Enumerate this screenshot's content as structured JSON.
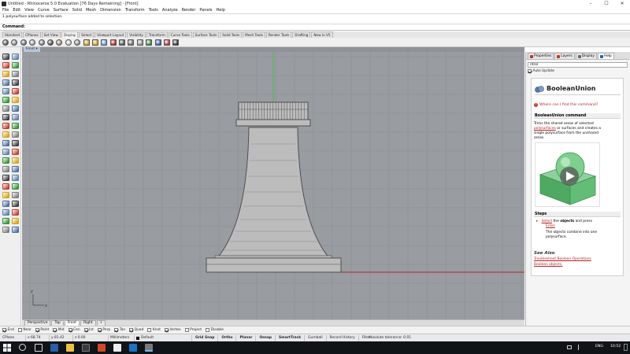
{
  "window": {
    "title": "Untitled - Rhinoceros 5.0 Evaluation [76 Days Remaining] - [Front]",
    "minimize": "–",
    "maximize": "☐",
    "close": "✕"
  },
  "menu": [
    "File",
    "Edit",
    "View",
    "Curve",
    "Surface",
    "Solid",
    "Mesh",
    "Dimension",
    "Transform",
    "Tools",
    "Analyze",
    "Render",
    "Panels",
    "Help"
  ],
  "history": "1 polysurface added to selection.",
  "command": {
    "label": "Command:",
    "value": ""
  },
  "toolbar_tabs": [
    {
      "label": "Standard",
      "active": false
    },
    {
      "label": "CPlanes",
      "active": false
    },
    {
      "label": "Set View",
      "active": false
    },
    {
      "label": "Display",
      "active": true
    },
    {
      "label": "Select",
      "active": false
    },
    {
      "label": "Viewport Layout",
      "active": false
    },
    {
      "label": "Visibility",
      "active": false
    },
    {
      "label": "Transform",
      "active": false
    },
    {
      "label": "Curve Tools",
      "active": false
    },
    {
      "label": "Surface Tools",
      "active": false
    },
    {
      "label": "Solid Tools",
      "active": false
    },
    {
      "label": "Mesh Tools",
      "active": false
    },
    {
      "label": "Render Tools",
      "active": false
    },
    {
      "label": "Drafting",
      "active": false
    },
    {
      "label": "New in V5",
      "active": false
    }
  ],
  "toolbar_icons": [
    {
      "name": "wireframe-sphere-icon",
      "color": "#4d4d4d"
    },
    {
      "name": "shaded-sphere-icon",
      "color": "#808080"
    },
    {
      "name": "rendered-sphere-icon",
      "color": "#5a6a7a"
    },
    {
      "name": "ghosted-sphere-icon",
      "color": "#9aa0a6"
    },
    {
      "name": "xray-sphere-icon",
      "color": "#7a7a7a"
    },
    {
      "name": "technical-sphere-icon",
      "color": "#3a3a3a"
    },
    {
      "name": "artistic-sphere-icon",
      "color": "#a08060"
    },
    {
      "name": "pen-sphere-icon",
      "color": "#c8c8c8"
    },
    {
      "name": "toggle-shade-icon",
      "color": "#8a8a8a"
    },
    {
      "name": "lock-icon",
      "color": "#d4a017"
    },
    {
      "name": "unlock-icon",
      "color": "#d4a017"
    },
    {
      "name": "grid-icon",
      "color": "#6a9bd0"
    },
    {
      "name": "axes-icon",
      "color": "#c02020"
    },
    {
      "name": "wireframe-display-icon",
      "color": "#505050"
    },
    {
      "name": "sphere-shaded-icon",
      "color": "#707070"
    },
    {
      "name": "sphere-render-icon",
      "color": "#909090"
    },
    {
      "name": "flip-normal-icon",
      "color": "#2f8f2f"
    },
    {
      "name": "light-icon",
      "color": "#3060b0"
    },
    {
      "name": "hide-icon",
      "color": "#c03030"
    },
    {
      "name": "display-options-icon",
      "color": "#333333"
    }
  ],
  "left_tools": [
    "select-arrow-icon",
    "point-icon",
    "polyline-icon",
    "curve-icon",
    "circle-icon",
    "arc-icon",
    "ellipse-icon",
    "rectangle-icon",
    "polygon-icon",
    "text-icon",
    "surface-corner-icon",
    "extrude-icon",
    "loft-icon",
    "revolve-icon",
    "sweep-icon",
    "patch-icon",
    "solid-box-icon",
    "solid-sphere-icon",
    "boolean-union-icon",
    "boolean-difference-icon",
    "mesh-icon",
    "render-icon",
    "fillet-icon",
    "chamfer-icon",
    "join-icon",
    "explode-icon",
    "trim-icon",
    "split-icon",
    "move-icon",
    "copy-icon",
    "rotate-icon",
    "scale-icon",
    "mirror-icon",
    "array-icon",
    "dimension-icon",
    "layer-icon",
    "analyze-icon",
    "snapshot-icon",
    "grid-tool-icon",
    "named-view-icon",
    "hatch-icon",
    "properties-icon"
  ],
  "viewport": {
    "label": "Front",
    "menu_arrow": "▾",
    "model": "rook-chess-piece",
    "axis_x": "x",
    "axis_z": "z"
  },
  "view_tabs": [
    {
      "label": "Perspective",
      "active": false
    },
    {
      "label": "Top",
      "active": false
    },
    {
      "label": "Front",
      "active": true
    },
    {
      "label": "Right",
      "active": false
    },
    {
      "label": "+",
      "active": false
    }
  ],
  "osnaps": [
    {
      "label": "End",
      "checked": true
    },
    {
      "label": "Near",
      "checked": false
    },
    {
      "label": "Point",
      "checked": true
    },
    {
      "label": "Mid",
      "checked": true
    },
    {
      "label": "Cen",
      "checked": true
    },
    {
      "label": "Int",
      "checked": true
    },
    {
      "label": "Perp",
      "checked": true
    },
    {
      "label": "Tan",
      "checked": true
    },
    {
      "label": "Quad",
      "checked": true
    },
    {
      "label": "Knot",
      "checked": false
    },
    {
      "label": "Vertex",
      "checked": true
    },
    {
      "label": "Project",
      "checked": false
    },
    {
      "label": "Disable",
      "checked": false
    }
  ],
  "status": {
    "cplane": "CPlane",
    "x": "x 68.74",
    "y": "y 81.42",
    "z": "z 0.00",
    "units": "Millimeters",
    "layer": "Default",
    "toggles": [
      {
        "label": "Grid Snap",
        "bold": true
      },
      {
        "label": "Ortho",
        "bold": true
      },
      {
        "label": "Planar",
        "bold": true
      },
      {
        "label": "Osnap",
        "bold": true
      },
      {
        "label": "SmartTrack",
        "bold": true
      },
      {
        "label": "Gumball",
        "bold": false
      },
      {
        "label": "Record History",
        "bold": false
      },
      {
        "label": "Filter",
        "bold": false
      }
    ],
    "tolerance": "Absolute tolerance: 0.01"
  },
  "panel": {
    "tabs": [
      {
        "label": "Properties",
        "active": false,
        "color": "#b0382d"
      },
      {
        "label": "Layers",
        "active": false,
        "color": "#c0392b"
      },
      {
        "label": "Display",
        "active": false,
        "color": "#5a6b7a"
      },
      {
        "label": "Help",
        "active": true,
        "color": "#2a60b0"
      }
    ],
    "search_value": "ntrol",
    "auto_update": "Auto Update",
    "help": {
      "title": "BooleanUnion",
      "where_link": "Where can I find this command?",
      "cmd_heading": "BooleanUnion command",
      "desc_1": "Trims the shared areas of selected",
      "desc_2": "polysurfaces",
      "desc_3": "or surfaces and creates a",
      "desc_4": "single polysurface from the unshared",
      "desc_5": "areas.",
      "steps_heading": "Steps",
      "step_1a": "Select",
      "step_1b": "the",
      "step_1c": "objects",
      "step_1d": "and press",
      "step_1e": "Enter",
      "step_2a": "The objects combine into one",
      "step_2b": "polysurface.",
      "see_also_heading": "See Also",
      "see_also_1": "Troubleshoot Boolean Operations",
      "see_also_2": "Boolean objects."
    }
  },
  "taskbar": {
    "lang": "ENG",
    "time": "10:52"
  },
  "colors": {
    "viewport_bg": "#999ca1",
    "grid_line": "#8b8e93",
    "axis_green": "#3cc23c",
    "axis_red": "#b3232a",
    "model_fill": "#bdbcbd",
    "model_stroke": "#505050",
    "panel_bg": "#f4f4f4",
    "link_red": "#b22222"
  }
}
